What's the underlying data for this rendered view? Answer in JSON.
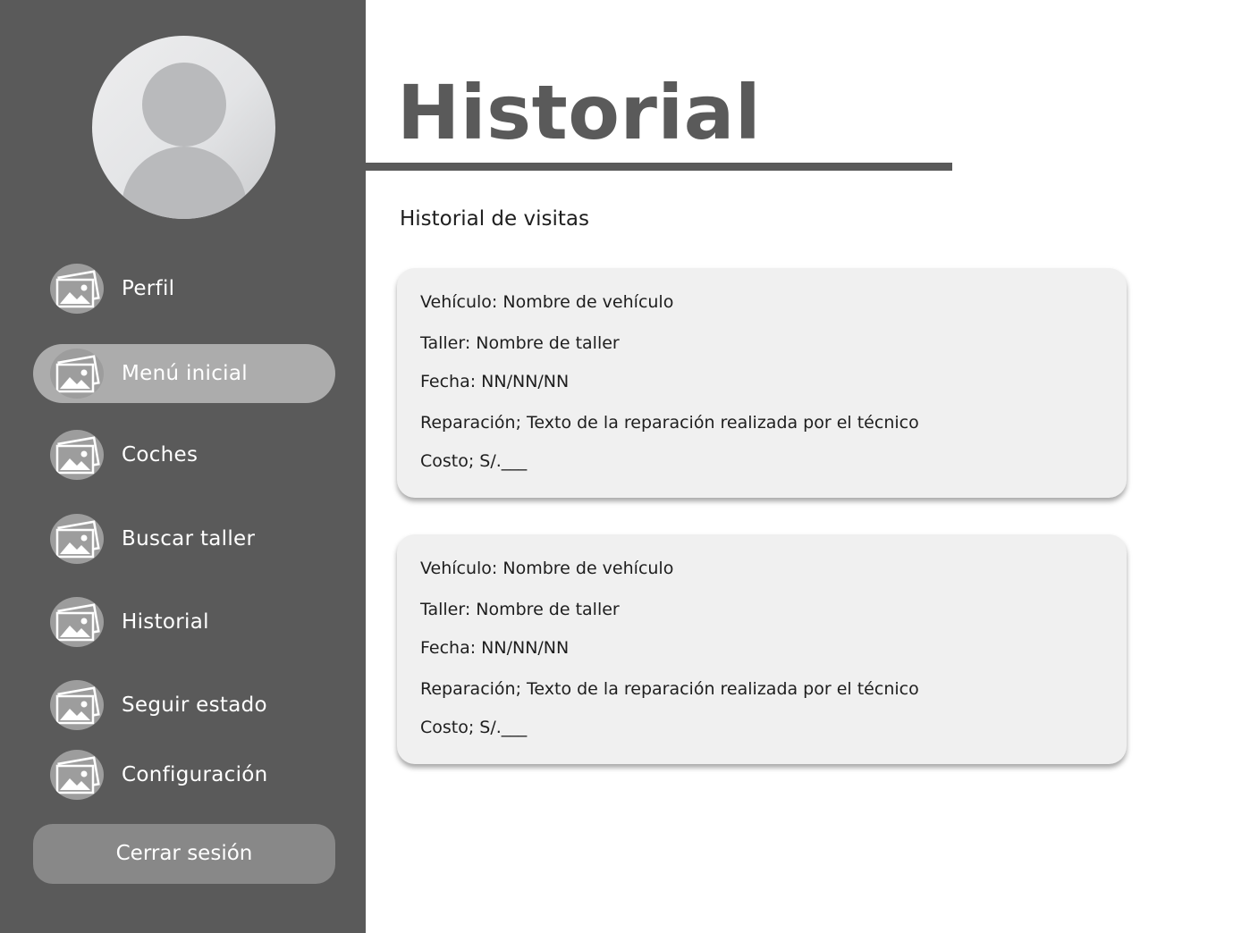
{
  "sidebar": {
    "items": [
      {
        "label": "Perfil",
        "icon": "image-icon",
        "active": false
      },
      {
        "label": "Menú inicial",
        "icon": "image-icon",
        "active": true
      },
      {
        "label": "Coches",
        "icon": "image-icon",
        "active": false
      },
      {
        "label": "Buscar taller",
        "icon": "image-icon",
        "active": false
      },
      {
        "label": "Historial",
        "icon": "image-icon",
        "active": false
      },
      {
        "label": "Seguir estado",
        "icon": "image-icon",
        "active": false
      },
      {
        "label": "Configuración",
        "icon": "image-icon",
        "active": false
      }
    ],
    "logout_label": "Cerrar sesión"
  },
  "main": {
    "title": "Historial",
    "subtitle": "Historial de visitas",
    "visits": [
      {
        "vehicle": "Vehículo: Nombre de vehículo",
        "workshop": "Taller: Nombre de taller",
        "date": "Fecha: NN/NN/NN",
        "repair": "Reparación; Texto de la reparación realizada por el técnico",
        "cost": "Costo;  S/.___"
      },
      {
        "vehicle": "Vehículo: Nombre de vehículo",
        "workshop": "Taller: Nombre de taller",
        "date": "Fecha: NN/NN/NN",
        "repair": "Reparación; Texto de la reparación realizada por el técnico",
        "cost": "Costo;  S/.___"
      }
    ]
  },
  "colors": {
    "sidebar_bg": "#5a5a5a",
    "active_item_bg": "#acacac",
    "logout_bg": "#888888",
    "card_bg": "#f0f0f0",
    "title_color": "#5a5a5a"
  }
}
